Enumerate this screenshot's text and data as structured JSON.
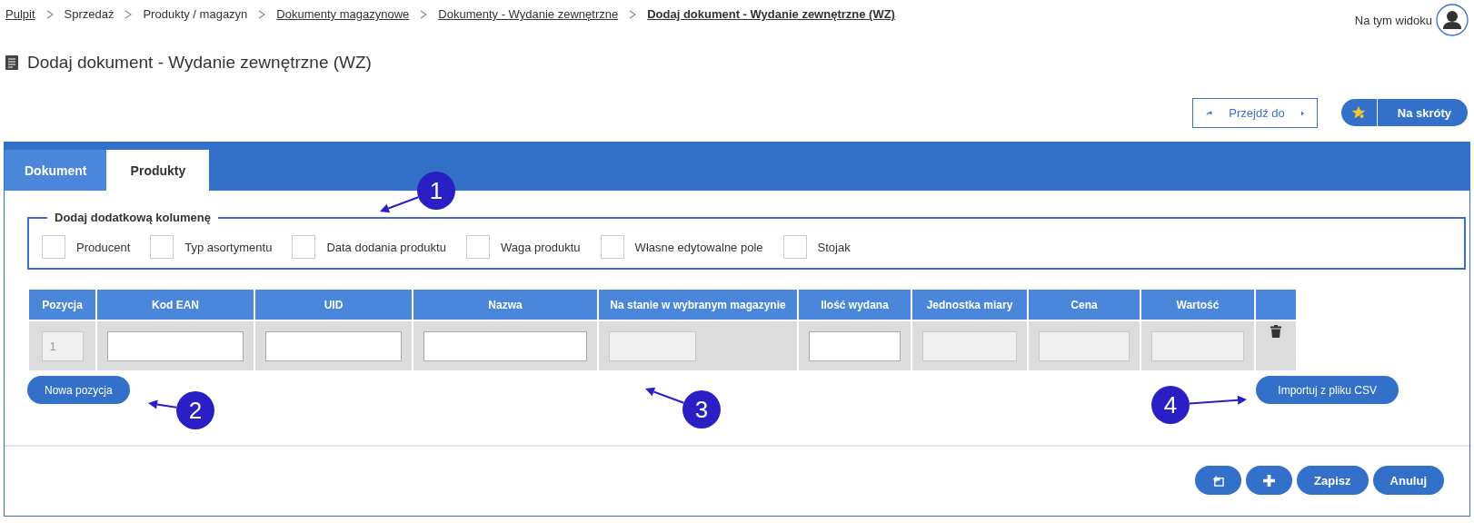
{
  "breadcrumbs": [
    {
      "label": "Pulpit",
      "kind": "link"
    },
    {
      "label": "Sprzedaż",
      "kind": "text"
    },
    {
      "label": "Produkty / magazyn",
      "kind": "text"
    },
    {
      "label": "Dokumenty magazynowe",
      "kind": "link"
    },
    {
      "label": "Dokumenty - Wydanie zewnętrzne",
      "kind": "link"
    },
    {
      "label": "Dodaj dokument - Wydanie zewnętrzne (WZ)",
      "kind": "current"
    }
  ],
  "user_menu": {
    "label": "Na tym widoku"
  },
  "page_title": "Dodaj dokument - Wydanie zewnętrzne (WZ)",
  "toolbar": {
    "goto": "Przejdź do",
    "shortcuts": "Na skróty"
  },
  "tabs": [
    {
      "label": "Dokument",
      "selected": false
    },
    {
      "label": "Produkty",
      "selected": true
    }
  ],
  "extra_columns": {
    "legend": "Dodaj dodatkową kolumenę",
    "options": [
      {
        "label": "Producent",
        "checked": false
      },
      {
        "label": "Typ asortymentu",
        "checked": false
      },
      {
        "label": "Data dodania produktu",
        "checked": false
      },
      {
        "label": "Waga produktu",
        "checked": false
      },
      {
        "label": "Własne edytowalne pole",
        "checked": false
      },
      {
        "label": "Stojak",
        "checked": false
      }
    ]
  },
  "table": {
    "columns": [
      "Pozycja",
      "Kod EAN",
      "UID",
      "Nazwa",
      "Na stanie w wybranym magazynie",
      "Ilość wydana",
      "Jednostka miary",
      "Cena",
      "Wartość",
      ""
    ],
    "rows": [
      {
        "cells": [
          {
            "kind": "readonly",
            "value": "1"
          },
          {
            "kind": "input"
          },
          {
            "kind": "input"
          },
          {
            "kind": "input"
          },
          {
            "kind": "readonly"
          },
          {
            "kind": "input"
          },
          {
            "kind": "readonly"
          },
          {
            "kind": "readonly"
          },
          {
            "kind": "readonly"
          },
          {
            "kind": "delete"
          }
        ]
      }
    ]
  },
  "new_row_button": "Nowa pozycja",
  "import_button": "Importuj z pliku CSV",
  "footer_buttons": [
    {
      "kind": "icon-back"
    },
    {
      "kind": "icon-add"
    },
    {
      "kind": "text",
      "label": "Zapisz"
    },
    {
      "kind": "text",
      "label": "Anuluj"
    }
  ],
  "callouts": [
    {
      "label": "1"
    },
    {
      "label": "2"
    },
    {
      "label": "3"
    },
    {
      "label": "4"
    }
  ]
}
